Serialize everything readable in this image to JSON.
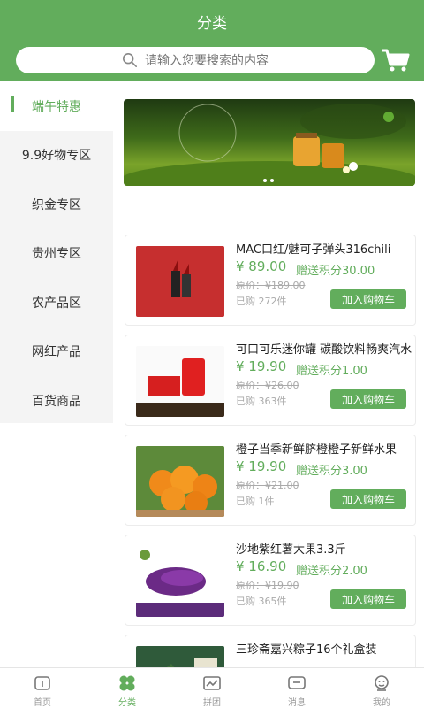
{
  "header": {
    "title": "分类",
    "search_placeholder": "请输入您要搜索的内容"
  },
  "colors": {
    "primary": "#62ad5c"
  },
  "sidebar": {
    "items": [
      {
        "label": "端午特惠",
        "active": true
      },
      {
        "label": "9.9好物专区"
      },
      {
        "label": "织金专区"
      },
      {
        "label": "贵州专区"
      },
      {
        "label": "农产品区"
      },
      {
        "label": "网红产品"
      },
      {
        "label": "百货商品"
      }
    ]
  },
  "products": [
    {
      "name": "MAC口红/魅可子弹头316chili",
      "price": "¥ 89.00",
      "points": "赠送积分30.00",
      "orig": "原价：¥189.00",
      "sold": "已购 272件",
      "btn": "加入购物车"
    },
    {
      "name": "可口可乐迷你罐 碳酸饮料畅爽汽水",
      "price": "¥ 19.90",
      "points": "赠送积分1.00",
      "orig": "原价：¥26.00",
      "sold": "已购 363件",
      "btn": "加入购物车"
    },
    {
      "name": "橙子当季新鲜脐橙橙子新鲜水果",
      "price": "¥ 19.90",
      "points": "赠送积分3.00",
      "orig": "原价：¥21.00",
      "sold": "已购 1件",
      "btn": "加入购物车"
    },
    {
      "name": "沙地紫红薯大果3.3斤",
      "price": "¥ 16.90",
      "points": "赠送积分2.00",
      "orig": "原价：¥19.90",
      "sold": "已购 365件",
      "btn": "加入购物车"
    },
    {
      "name": "三珍斋嘉兴粽子16个礼盒装"
    }
  ],
  "tabs": [
    {
      "label": "首页",
      "icon": "home-icon"
    },
    {
      "label": "分类",
      "icon": "category-icon",
      "active": true
    },
    {
      "label": "拼团",
      "icon": "group-buy-icon"
    },
    {
      "label": "消息",
      "icon": "message-icon"
    },
    {
      "label": "我的",
      "icon": "profile-icon"
    }
  ]
}
